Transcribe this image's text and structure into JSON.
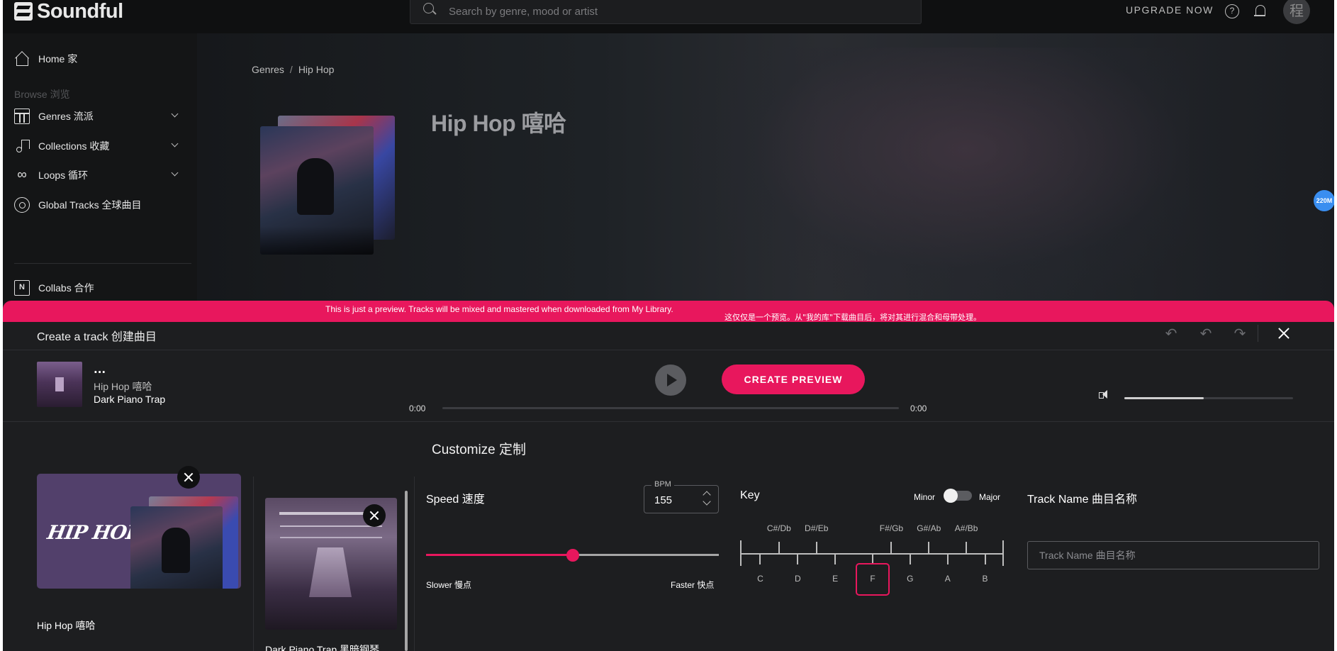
{
  "app": {
    "brand": "Soundful",
    "search_placeholder": "Search by genre, mood or artist",
    "upgrade_label": "UPGRADE NOW",
    "help_glyph": "?",
    "avatar_text": "程"
  },
  "sidebar": {
    "home": "Home 家",
    "browse_heading": "Browse 浏览",
    "items": [
      {
        "label": "Genres 流派",
        "icon": "grid-icon"
      },
      {
        "label": "Collections 收藏",
        "icon": "music-note-icon"
      },
      {
        "label": "Loops 循环",
        "icon": "infinity-icon"
      },
      {
        "label": "Global Tracks 全球曲目",
        "icon": "disc-icon"
      }
    ],
    "collabs": "Collabs 合作"
  },
  "hero": {
    "breadcrumb": [
      "Genres",
      "Hip Hop"
    ],
    "breadcrumb_sep": "/",
    "title": "Hip Hop 嘻哈"
  },
  "badge": "220M",
  "banner": {
    "text_en": "This is just a preview. Tracks will be mixed and mastered when downloaded from My Library.",
    "text_zh": "这仅仅是一个预览。从\"我的库\"下载曲目后，将对其进行混合和母带处理。"
  },
  "creator": {
    "title": "Create a track 创建曲目",
    "player": {
      "dots": "...",
      "genre": "Hip Hop 嘻哈",
      "track": "Dark Piano Trap",
      "time_current": "0:00",
      "time_total": "0:00",
      "create_label": "CREATE PREVIEW",
      "volume": 0.47
    },
    "customize_title": "Customize 定制",
    "cards": [
      {
        "logo_text": "HIP HOP",
        "label": "Hip Hop 嘻哈"
      },
      {
        "label": "Dark Piano Trap 黑暗钢琴"
      }
    ],
    "speed": {
      "title": "Speed 速度",
      "bpm_label": "BPM",
      "bpm": "155",
      "slider_value": 0.5,
      "slower": "Slower 慢点",
      "faster": "Faster 快点"
    },
    "key": {
      "title": "Key",
      "minor": "Minor",
      "major": "Major",
      "naturals": [
        "C",
        "D",
        "E",
        "F",
        "G",
        "A",
        "B"
      ],
      "sharps": [
        "C#/Db",
        "D#/Eb",
        "F#/Gb",
        "G#/Ab",
        "A#/Bb"
      ],
      "selected": "F"
    },
    "track_name": {
      "title": "Track Name 曲目名称",
      "placeholder": "Track Name 曲目名称"
    }
  },
  "colors": {
    "accent": "#e8175d",
    "background": "#1d1e20",
    "topbar": "#0f1011"
  }
}
